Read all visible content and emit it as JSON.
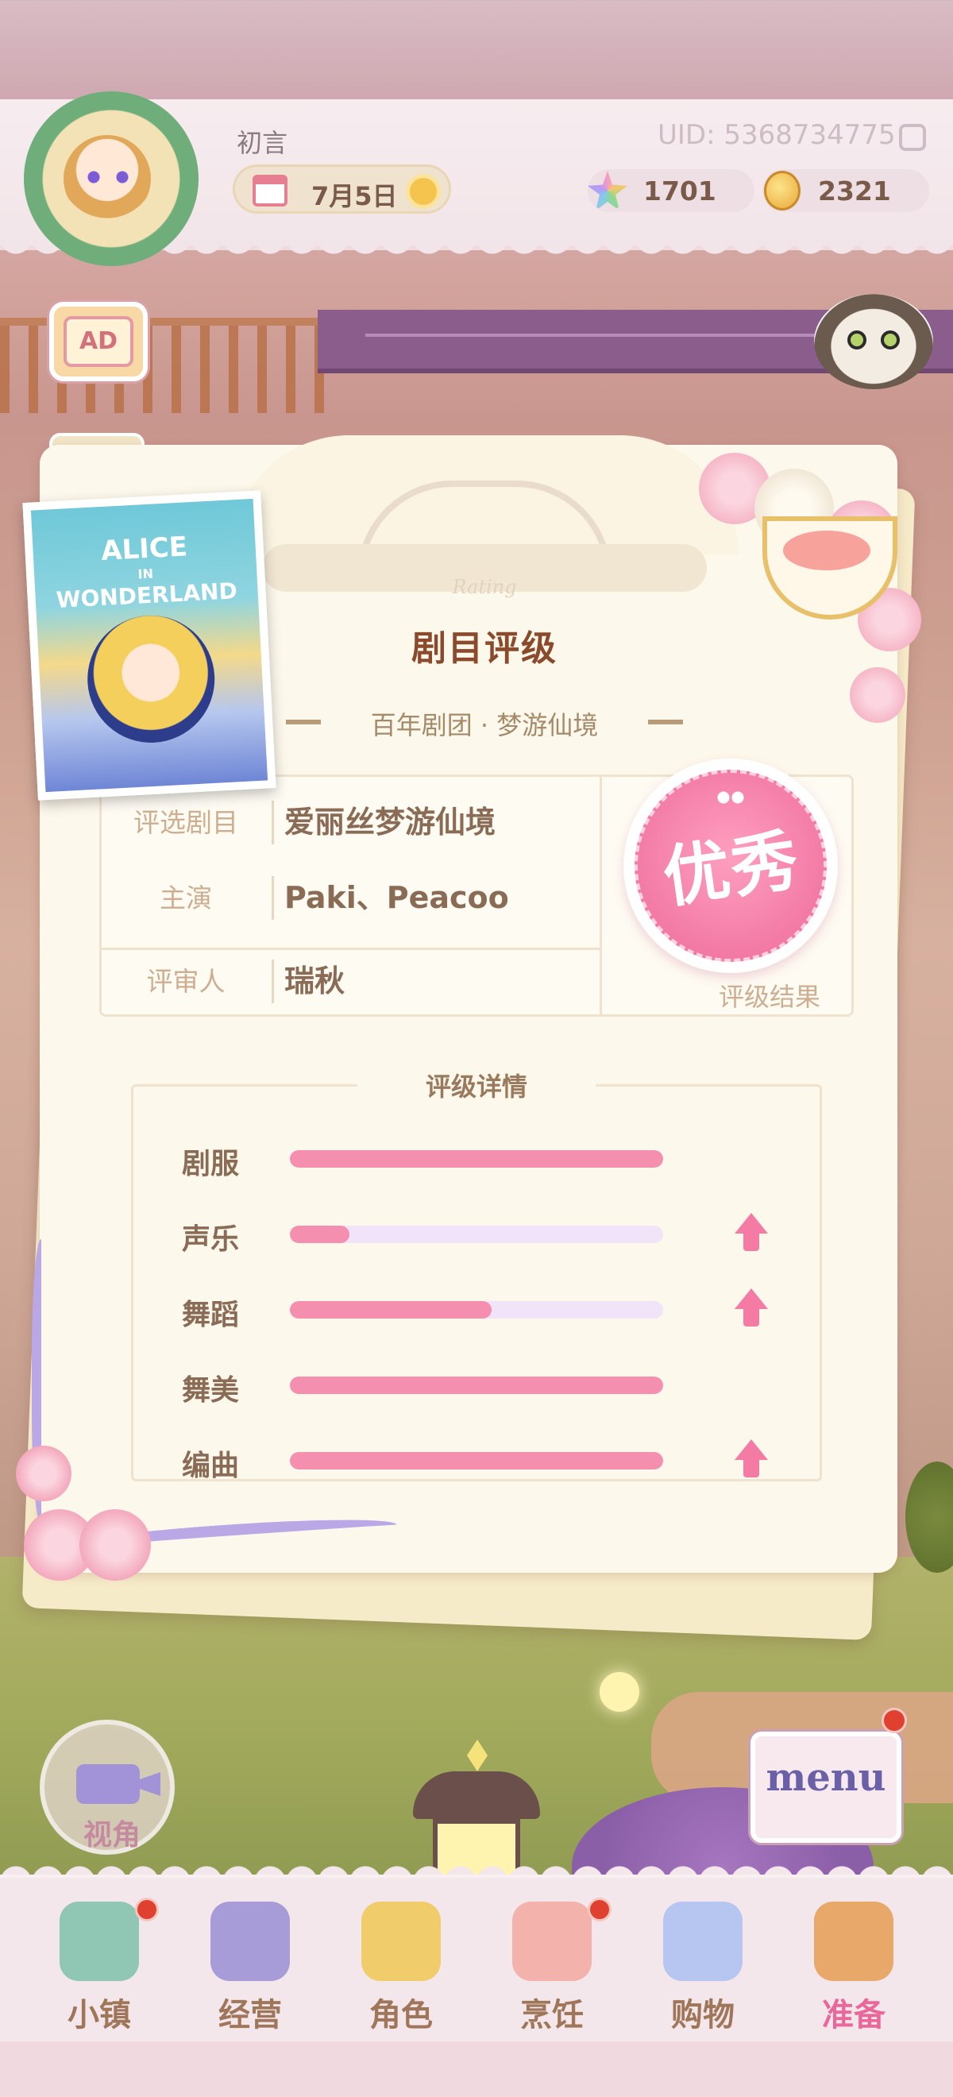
{
  "header": {
    "player_name": "初言",
    "date": "7月5日",
    "uid": "UID: 5368734775",
    "gems": "1701",
    "coins": "2321"
  },
  "ad_button": {
    "label": "AD"
  },
  "poster": {
    "line1": "ALICE",
    "line2": "IN",
    "line3": "WONDERLAND"
  },
  "rating_card": {
    "title": "剧目评级",
    "subtitle": "百年剧团 · 梦游仙境",
    "rating_watermark": "Rating",
    "info": [
      {
        "label": "评选剧目",
        "value": "爱丽丝梦游仙境"
      },
      {
        "label": "主演",
        "value": "Paki、Peacoo"
      },
      {
        "label": "评审人",
        "value": "瑞秋"
      }
    ],
    "result": {
      "grade": "优秀",
      "label": "评级结果"
    },
    "detail_title": "评级详情",
    "stats": [
      {
        "name": "剧服",
        "fill": 1.0,
        "upgrade": false
      },
      {
        "name": "声乐",
        "fill": 0.16,
        "upgrade": true
      },
      {
        "name": "舞蹈",
        "fill": 0.54,
        "upgrade": true
      },
      {
        "name": "舞美",
        "fill": 1.0,
        "upgrade": false
      },
      {
        "name": "编曲",
        "fill": 1.0,
        "upgrade": true
      }
    ]
  },
  "view_button": {
    "label": "视角"
  },
  "menu_button": {
    "label": "menu"
  },
  "nav": {
    "items": [
      {
        "label": "小镇",
        "icon": "map-icon",
        "badge": true,
        "active": false,
        "color": "#8fc6b4"
      },
      {
        "label": "经营",
        "icon": "shop-bag-icon",
        "badge": false,
        "active": false,
        "color": "#a79bd8"
      },
      {
        "label": "角色",
        "icon": "character-icon",
        "badge": false,
        "active": false,
        "color": "#f0cc6a"
      },
      {
        "label": "烹饪",
        "icon": "sandwich-icon",
        "badge": true,
        "active": false,
        "color": "#f3b2ab"
      },
      {
        "label": "购物",
        "icon": "shopping-bag-icon",
        "badge": false,
        "active": false,
        "color": "#b6c6f0"
      },
      {
        "label": "准备",
        "icon": "basket-icon",
        "badge": false,
        "active": true,
        "color": "#e7a86a"
      }
    ]
  },
  "colors": {
    "accent_pink": "#f58fb0",
    "track_lavender": "#f1e3f8",
    "title_brown": "#8b4a2b",
    "badge_red": "#e0402f"
  }
}
